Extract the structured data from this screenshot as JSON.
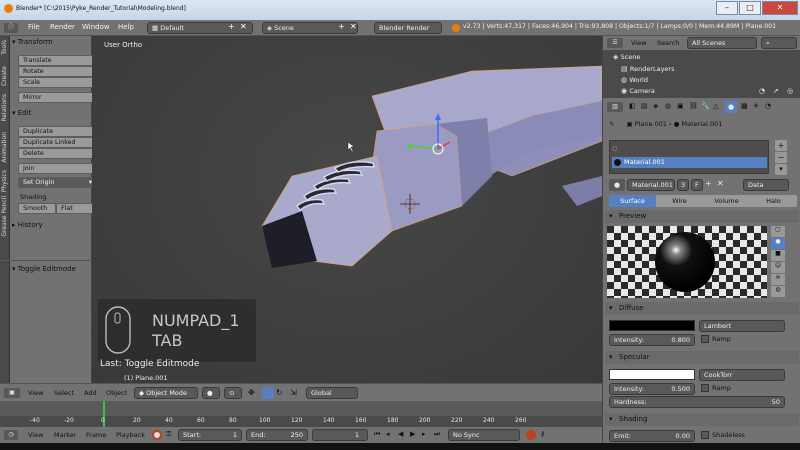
{
  "window": {
    "title": "Blender* [C:\\2015\\Pyke_Render_Tutorial\\Modeling.blend]",
    "btn_min": "–",
    "btn_max": "□",
    "btn_close": "✕"
  },
  "menu": [
    "File",
    "Render",
    "Window",
    "Help"
  ],
  "header": {
    "layout": "Default",
    "scene": "Scene",
    "engine": "Blender Render",
    "stats": "v2.73 | Verts:47,317 | Faces:46,904 | Tris:93,808 | Objects:1/7 | Lamps:0/0 | Mem:44.89M | Plane.001"
  },
  "left_tabs": [
    "Tools",
    "Create",
    "Relations",
    "Animation",
    "Physics",
    "Grease Pencil"
  ],
  "tool_panel": {
    "transform_title": "Transform",
    "transform_buttons": [
      "Translate",
      "Rotate",
      "Scale",
      "Mirror"
    ],
    "edit_title": "Edit",
    "edit_buttons": [
      "Duplicate",
      "Duplicate Linked",
      "Delete",
      "Join"
    ],
    "set_origin": "Set Origin",
    "shading_label": "Shading",
    "smooth": "Smooth",
    "flat": "Flat",
    "history_title": "History",
    "toggle_editmode": "Toggle Editmode"
  },
  "viewport": {
    "label": "User Ortho",
    "key_primary": "NUMPAD_1",
    "key_secondary": "TAB",
    "last_op": "Last: Toggle Editmode",
    "object_info": "(1) Plane.001"
  },
  "view3d_header": {
    "view": "View",
    "select": "Select",
    "add": "Add",
    "object": "Object",
    "mode": "Object Mode",
    "orientation": "Global"
  },
  "timeline": {
    "ticks": [
      "-40",
      "-20",
      "0",
      "20",
      "40",
      "60",
      "80",
      "100",
      "120",
      "140",
      "160",
      "180",
      "200",
      "220",
      "240",
      "260"
    ],
    "view": "View",
    "marker": "Marker",
    "frame": "Frame",
    "playback": "Playback",
    "start_label": "Start:",
    "start_value": "1",
    "end_label": "End:",
    "end_value": "250",
    "current": "1",
    "sync": "No Sync"
  },
  "outliner": {
    "view": "View",
    "search": "Search",
    "filter": "All Scenes",
    "items": [
      "Scene",
      "RenderLayers",
      "World",
      "Camera"
    ]
  },
  "properties": {
    "breadcrumb_object": "Plane.001",
    "breadcrumb_material": "Material.001",
    "slot": "Material.001",
    "material_name": "Material.001",
    "users": "3",
    "f_label": "F",
    "link": "Data",
    "tabs": [
      "Surface",
      "Wire",
      "Volume",
      "Halo"
    ],
    "preview_title": "Preview",
    "diffuse_title": "Diffuse",
    "diffuse_shader": "Lambert",
    "intensity_label": "Intensity:",
    "diffuse_intensity": "0.800",
    "ramp": "Ramp",
    "specular_title": "Specular",
    "specular_shader": "CookTorr",
    "specular_intensity": "0.500",
    "hardness_label": "Hardness:",
    "hardness": "50",
    "shading_title": "Shading",
    "emit_label": "Emit:",
    "emit": "0.00",
    "shadeless": "Shadeless"
  },
  "colors": {
    "accent_blue": "#5680c2",
    "diffuse_color": "#000000",
    "specular_color": "#ffffff"
  }
}
